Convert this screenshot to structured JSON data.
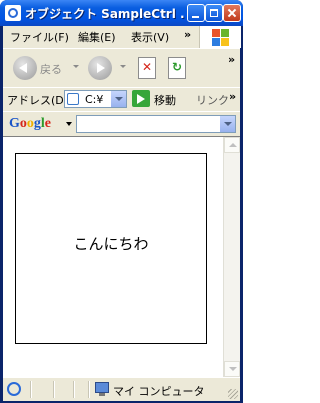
{
  "window": {
    "title": "オブジェクト SampleCtrl ..."
  },
  "menu": {
    "items": [
      "ファイル(F)",
      "編集(E)",
      "表示(V)"
    ],
    "more": "»"
  },
  "toolbar": {
    "back_label": "戻る",
    "more": "»"
  },
  "address": {
    "label": "アドレス(D)",
    "value": "C:¥",
    "go_label": "移動",
    "links_label": "リンク",
    "more": "»"
  },
  "google": {
    "logo": "Google",
    "search_value": ""
  },
  "content": {
    "text": "こんにちわ"
  },
  "status": {
    "zone": "マイ コンピュータ"
  }
}
